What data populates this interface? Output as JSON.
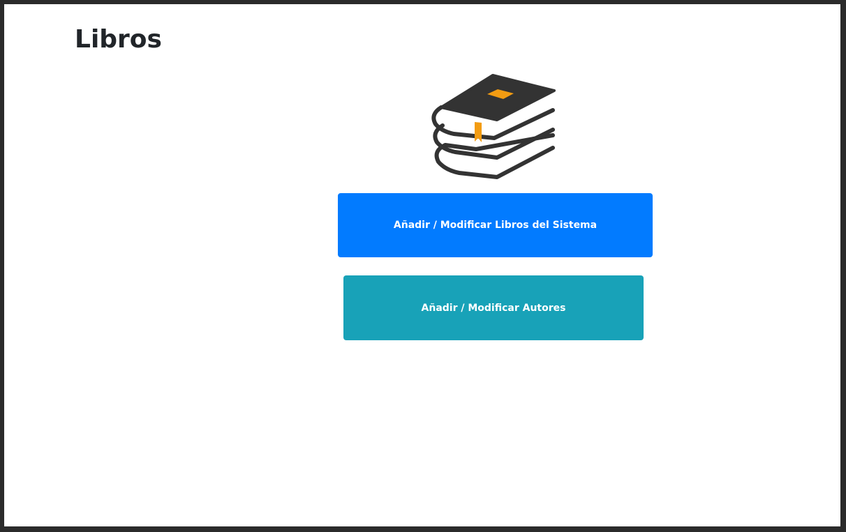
{
  "page": {
    "title": "Libros"
  },
  "icon": {
    "name": "books-stack-icon",
    "colors": {
      "cover": "#333333",
      "label": "#f39c12",
      "bookmark": "#f39c12",
      "pages": "#ffffff"
    }
  },
  "buttons": {
    "books_label": "Añadir / Modificar Libros del Sistema",
    "authors_label": "Añadir / Modificar Autores"
  },
  "colors": {
    "primary": "#027bff",
    "info": "#18a2b8",
    "frame": "#2b2b2b",
    "title_text": "#212529"
  }
}
